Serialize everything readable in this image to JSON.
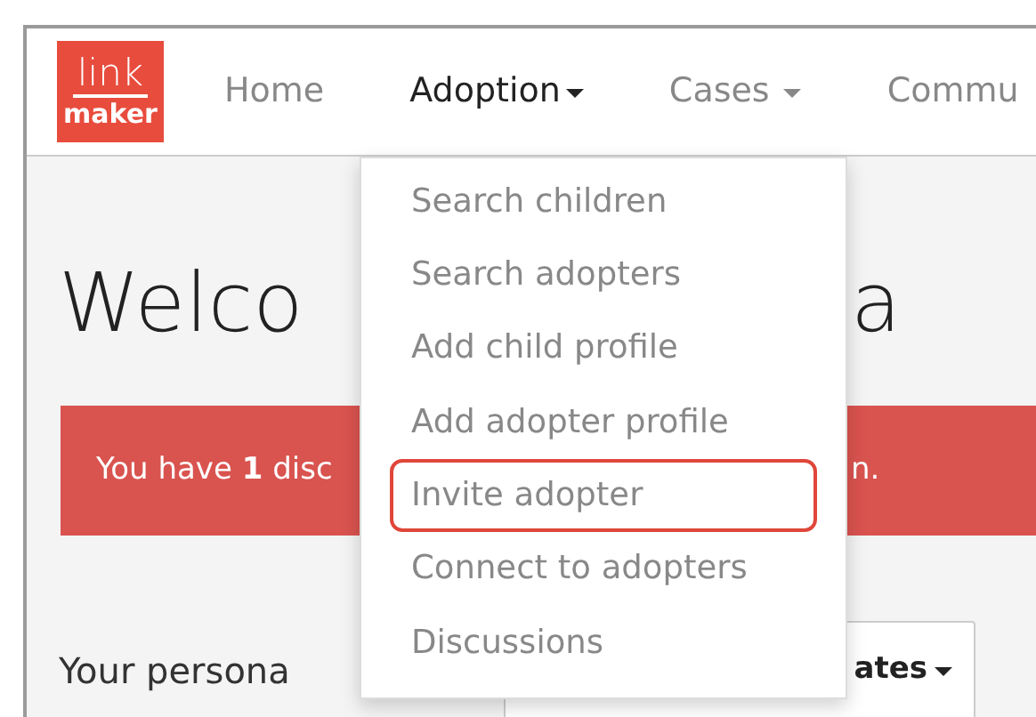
{
  "logo": {
    "line_1": "link",
    "line_2": "maker"
  },
  "nav": [
    {
      "label": "Home",
      "selected": false,
      "has_menu": false
    },
    {
      "label": "Adoption",
      "selected": true,
      "has_menu": true
    },
    {
      "label": "Cases",
      "selected": false,
      "has_menu": true
    },
    {
      "label": "Commu",
      "selected": false,
      "has_menu": false
    }
  ],
  "dropdown": [
    {
      "label": "Search children",
      "highlighted": false
    },
    {
      "label": "Search adopters",
      "highlighted": false
    },
    {
      "label": "Add child profile",
      "highlighted": false
    },
    {
      "label": "Add adopter profile",
      "highlighted": false
    },
    {
      "label": "Invite adopter",
      "highlighted": true
    },
    {
      "label": "Connect to adopters",
      "highlighted": false
    },
    {
      "label": "Discussions",
      "highlighted": false
    }
  ],
  "heading": {
    "left": "Welco",
    "right": "a"
  },
  "alert": {
    "left": "You have **1** disc",
    "right": "n."
  },
  "section_title": "Your persona",
  "updates_button": {
    "label": "ates"
  }
}
